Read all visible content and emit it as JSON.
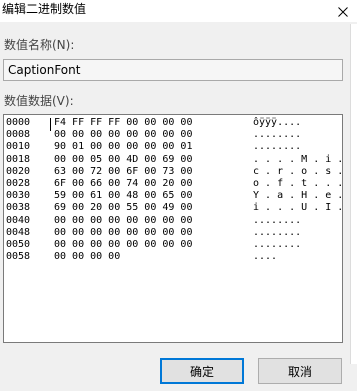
{
  "window": {
    "title": "编辑二进制数值"
  },
  "value_name": {
    "label": "数值名称(N):",
    "value": "CaptionFont"
  },
  "value_data": {
    "label": "数值数据(V):",
    "rows": [
      {
        "offset": "0000",
        "hex": "F4 FF FF FF 00 00 00 00",
        "ascii": "ôÿÿÿ...."
      },
      {
        "offset": "0008",
        "hex": "00 00 00 00 00 00 00 00",
        "ascii": "........"
      },
      {
        "offset": "0010",
        "hex": "90 01 00 00 00 00 00 01",
        "ascii": "........"
      },
      {
        "offset": "0018",
        "hex": "00 00 05 00 4D 00 69 00",
        "ascii": ". . . . M . i ."
      },
      {
        "offset": "0020",
        "hex": "63 00 72 00 6F 00 73 00",
        "ascii": "c . r . o . s ."
      },
      {
        "offset": "0028",
        "hex": "6F 00 66 00 74 00 20 00",
        "ascii": "o . f . t . . ."
      },
      {
        "offset": "0030",
        "hex": "59 00 61 00 48 00 65 00",
        "ascii": "Y . a . H . e ."
      },
      {
        "offset": "0038",
        "hex": "69 00 20 00 55 00 49 00",
        "ascii": "i . . . U . I ."
      },
      {
        "offset": "0040",
        "hex": "00 00 00 00 00 00 00 00",
        "ascii": "........"
      },
      {
        "offset": "0048",
        "hex": "00 00 00 00 00 00 00 00",
        "ascii": "........"
      },
      {
        "offset": "0050",
        "hex": "00 00 00 00 00 00 00 00",
        "ascii": "........"
      },
      {
        "offset": "0058",
        "hex": "00 00 00 00",
        "ascii": "...."
      }
    ]
  },
  "buttons": {
    "ok": "确定",
    "cancel": "取消"
  },
  "icons": {
    "close": "close-icon"
  }
}
